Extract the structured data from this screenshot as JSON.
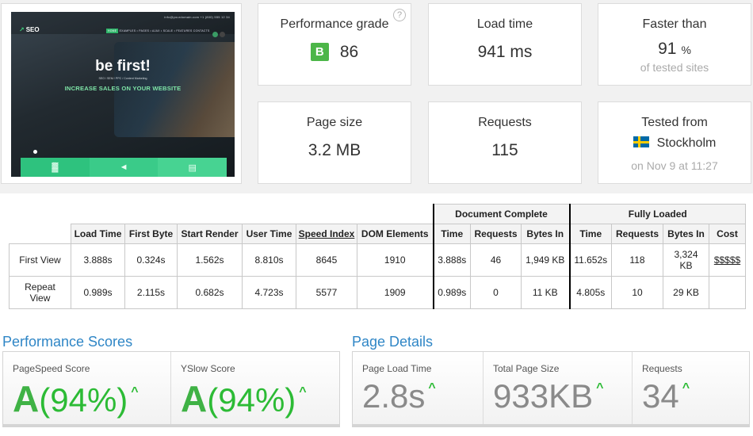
{
  "screenshot": {
    "top_line": "info@yourdomain.com   +1 (800) 555 12 34",
    "logo": "SEO",
    "menu": [
      "HOME",
      "EXAMPLES",
      "PAGES",
      "AJAX",
      "SCALE",
      "FEATURES",
      "CONTACTS"
    ],
    "headline": "be first!",
    "subline": "SEO / SEM / PPC / Content Marketing",
    "tagline": "INCREASE SALES ON YOUR WEBSITE"
  },
  "cards": {
    "performance": {
      "label": "Performance grade",
      "grade": "B",
      "value": "86",
      "help": "?"
    },
    "load_time": {
      "label": "Load time",
      "value": "941 ms"
    },
    "faster": {
      "label": "Faster than",
      "value": "91",
      "unit": "%",
      "sub": "of tested sites"
    },
    "page_size": {
      "label": "Page size",
      "value": "3.2 MB"
    },
    "requests": {
      "label": "Requests",
      "value": "115"
    },
    "tested": {
      "label": "Tested from",
      "location": "Stockholm",
      "sub": "on Nov 9 at 11:27"
    }
  },
  "table": {
    "group_headers": {
      "document_complete": "Document Complete",
      "fully_loaded": "Fully Loaded"
    },
    "headers": [
      "Load Time",
      "First Byte",
      "Start Render",
      "User Time",
      "Speed Index",
      "DOM Elements",
      "Time",
      "Requests",
      "Bytes In",
      "Time",
      "Requests",
      "Bytes In",
      "Cost"
    ],
    "rows": [
      {
        "label": "First View",
        "cells": [
          "3.888s",
          "0.324s",
          "1.562s",
          "8.810s",
          "8645",
          "1910",
          "3.888s",
          "46",
          "1,949 KB",
          "11.652s",
          "118",
          "3,324 KB",
          "$$$$$"
        ]
      },
      {
        "label": "Repeat View",
        "cells": [
          "0.989s",
          "2.115s",
          "0.682s",
          "4.723s",
          "5577",
          "1909",
          "0.989s",
          "0",
          "11 KB",
          "4.805s",
          "10",
          "29 KB",
          ""
        ]
      }
    ]
  },
  "performance_scores": {
    "title": "Performance Scores",
    "items": [
      {
        "label": "PageSpeed Score",
        "grade": "A",
        "value": "(94%)"
      },
      {
        "label": "YSlow Score",
        "grade": "A",
        "value": "(94%)"
      }
    ]
  },
  "page_details": {
    "title": "Page Details",
    "items": [
      {
        "label": "Page Load Time",
        "value": "2.8s"
      },
      {
        "label": "Total Page Size",
        "value": "933KB"
      },
      {
        "label": "Requests",
        "value": "34"
      }
    ]
  },
  "colors": {
    "accent_blue": "#2f86c6",
    "grade_green": "#4cb648",
    "score_green": "#2cbb35"
  },
  "icons": [
    "help-icon",
    "sweden-flag-icon",
    "arrow-up-icon"
  ]
}
